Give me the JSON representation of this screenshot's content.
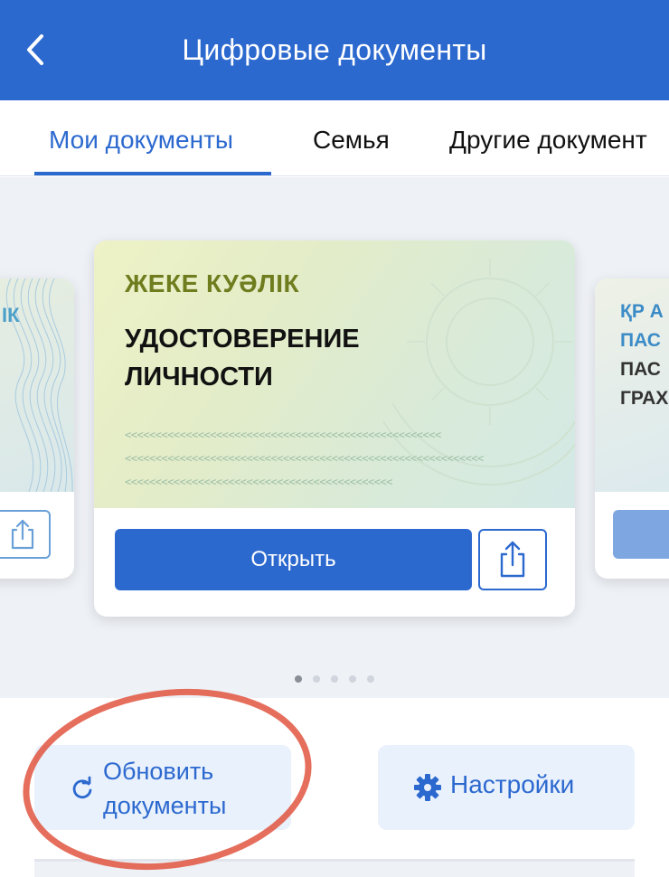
{
  "header": {
    "title": "Цифровые документы",
    "back_icon": "chevron-left-icon",
    "color": "#2c69cf"
  },
  "tabs": [
    {
      "label": "Мои документы",
      "active": true
    },
    {
      "label": "Семья",
      "active": false
    },
    {
      "label": "Другие документ",
      "active": false
    }
  ],
  "carousel": {
    "main_card": {
      "title_kz": "ЖЕКЕ КУӘЛІК",
      "title_ru": "УДОСТОВЕРЕНИЕ ЛИЧНОСТИ",
      "mrz_lines": [
        "<<<<<<<<<<<<<<<<<<<<<<<<<<<<<<<<<<<<<<<<<<<<<<<<<<<<",
        "<<<<<<<<<<<<<<<<<<<<<<<<<<<<<<<<<<<<<<<<<<<<<<<<<<<<<<<<<<<",
        "<<<<<<<<<<<<<<<<<<<<<<<<<<<<<<<<<<<<<<<<<<<<"
      ],
      "open_label": "Открыть",
      "share_icon": "share-icon"
    },
    "left_card": {
      "title_partial": "ІК"
    },
    "right_card": {
      "lines": [
        "ҚР А",
        "ПАС",
        "ПАС",
        "ГРАХ"
      ]
    },
    "page_count": 5,
    "active_page": 1
  },
  "actions": {
    "refresh_label": "Обновить документы",
    "refresh_icon": "refresh-icon",
    "settings_label": "Настройки",
    "settings_icon": "gear-icon"
  },
  "colors": {
    "accent": "#2c69cf",
    "annotation": "#e0553f"
  }
}
